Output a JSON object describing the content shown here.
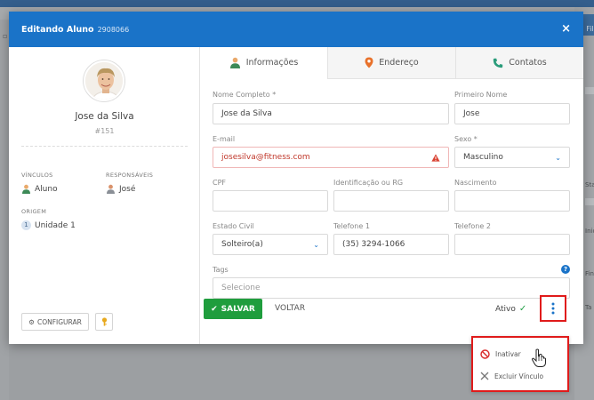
{
  "background": {
    "right_tab": "Fil",
    "right_labels": [
      "Sta",
      "Inic",
      "Fin",
      "Ta"
    ]
  },
  "modal": {
    "title": "Editando Aluno",
    "id": "2908066",
    "close": "×"
  },
  "profile": {
    "name": "Jose da Silva",
    "number": "#151",
    "vinculos_label": "VÍNCULOS",
    "vinculos_value": "Aluno",
    "responsaveis_label": "RESPONSÁVEIS",
    "responsaveis_value": "José",
    "origem_label": "ORIGEM",
    "origem_badge": "1",
    "origem_value": "Unidade 1",
    "configurar_label": "CONFIGURAR"
  },
  "tabs": [
    {
      "label": "Informações",
      "icon": "person-icon",
      "active": true
    },
    {
      "label": "Endereço",
      "icon": "map-pin-icon",
      "active": false
    },
    {
      "label": "Contatos",
      "icon": "phone-icon",
      "active": false
    }
  ],
  "form": {
    "nome_completo": {
      "label": "Nome Completo *",
      "value": "Jose da Silva"
    },
    "primeiro_nome": {
      "label": "Primeiro Nome",
      "value": "Jose"
    },
    "email": {
      "label": "E-mail",
      "value": "josesilva@fitness.com"
    },
    "sexo": {
      "label": "Sexo *",
      "value": "Masculino"
    },
    "cpf": {
      "label": "CPF",
      "value": ""
    },
    "identificacao": {
      "label": "Identificação ou RG",
      "value": ""
    },
    "nascimento": {
      "label": "Nascimento",
      "value": ""
    },
    "estado_civil": {
      "label": "Estado Civil",
      "value": "Solteiro(a)"
    },
    "telefone1": {
      "label": "Telefone 1",
      "value": "(35) 3294-1066"
    },
    "telefone2": {
      "label": "Telefone 2",
      "value": ""
    },
    "tags": {
      "label": "Tags",
      "placeholder": "Selecione"
    }
  },
  "footer": {
    "save_label": "SALVAR",
    "back_label": "VOLTAR",
    "status_label": "Ativo"
  },
  "menu": {
    "items": [
      {
        "label": "Inativar",
        "icon": "block-icon"
      },
      {
        "label": "Excluir Vínculo",
        "icon": "x-icon"
      }
    ]
  },
  "colors": {
    "header_blue": "#1a73c8",
    "save_green": "#1f9d3d",
    "highlight_red": "#e01b1b",
    "error_red": "#c0382b"
  }
}
